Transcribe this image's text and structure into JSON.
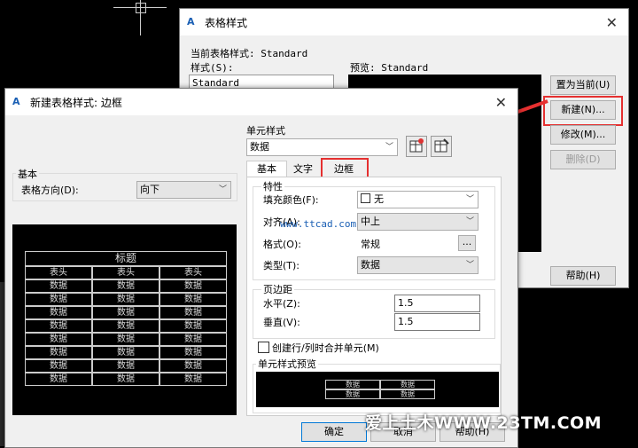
{
  "back_dialog": {
    "title": "表格样式",
    "current_style_label": "当前表格样式: Standard",
    "styles_label": "样式(S):",
    "styles_list": [
      "Standard"
    ],
    "preview_label": "预览: Standard",
    "buttons": {
      "set_current": "置为当前(U)",
      "new": "新建(N)...",
      "modify": "修改(M)...",
      "delete": "删除(D)",
      "help": "帮助(H)"
    }
  },
  "front_dialog": {
    "title": "新建表格样式: 边框",
    "basic_group_label": "基本",
    "table_direction_label": "表格方向(D):",
    "table_direction_value": "向下",
    "preview": {
      "title": "标题",
      "header_row": [
        "表头",
        "表头",
        "表头"
      ],
      "data_rows": [
        [
          "数据",
          "数据",
          "数据"
        ],
        [
          "数据",
          "数据",
          "数据"
        ],
        [
          "数据",
          "数据",
          "数据"
        ],
        [
          "数据",
          "数据",
          "数据"
        ],
        [
          "数据",
          "数据",
          "数据"
        ],
        [
          "数据",
          "数据",
          "数据"
        ],
        [
          "数据",
          "数据",
          "数据"
        ],
        [
          "数据",
          "数据",
          "数据"
        ]
      ]
    },
    "cell_style_label": "单元样式",
    "cell_style_value": "数据",
    "tabs": [
      "基本",
      "文字",
      "边框"
    ],
    "properties_label": "特性",
    "fill_color_label": "填充颜色(F):",
    "fill_color_value": "无",
    "alignment_label": "对齐(A):",
    "alignment_value": "中上",
    "format_label": "格式(O):",
    "format_value": "常规",
    "format_button": "...",
    "type_label": "类型(T):",
    "type_value": "数据",
    "margins_label": "页边距",
    "horizontal_label": "水平(Z):",
    "horizontal_value": "1.5",
    "vertical_label": "垂直(V):",
    "vertical_value": "1.5",
    "merge_label": "创建行/列时合并单元(M)",
    "cell_preview_label": "单元样式预览",
    "cell_preview_cells": [
      [
        "数据",
        "数据"
      ],
      [
        "数据",
        "数据"
      ]
    ],
    "buttons": {
      "ok": "确定",
      "cancel": "取消",
      "help": "帮助(H)"
    }
  },
  "watermarks": {
    "center": "www.ttcad.com",
    "bottom": "爱上土木WWW.23TM.COM"
  },
  "colors": {
    "highlight": "#e53030",
    "arrow": "#e53030"
  }
}
